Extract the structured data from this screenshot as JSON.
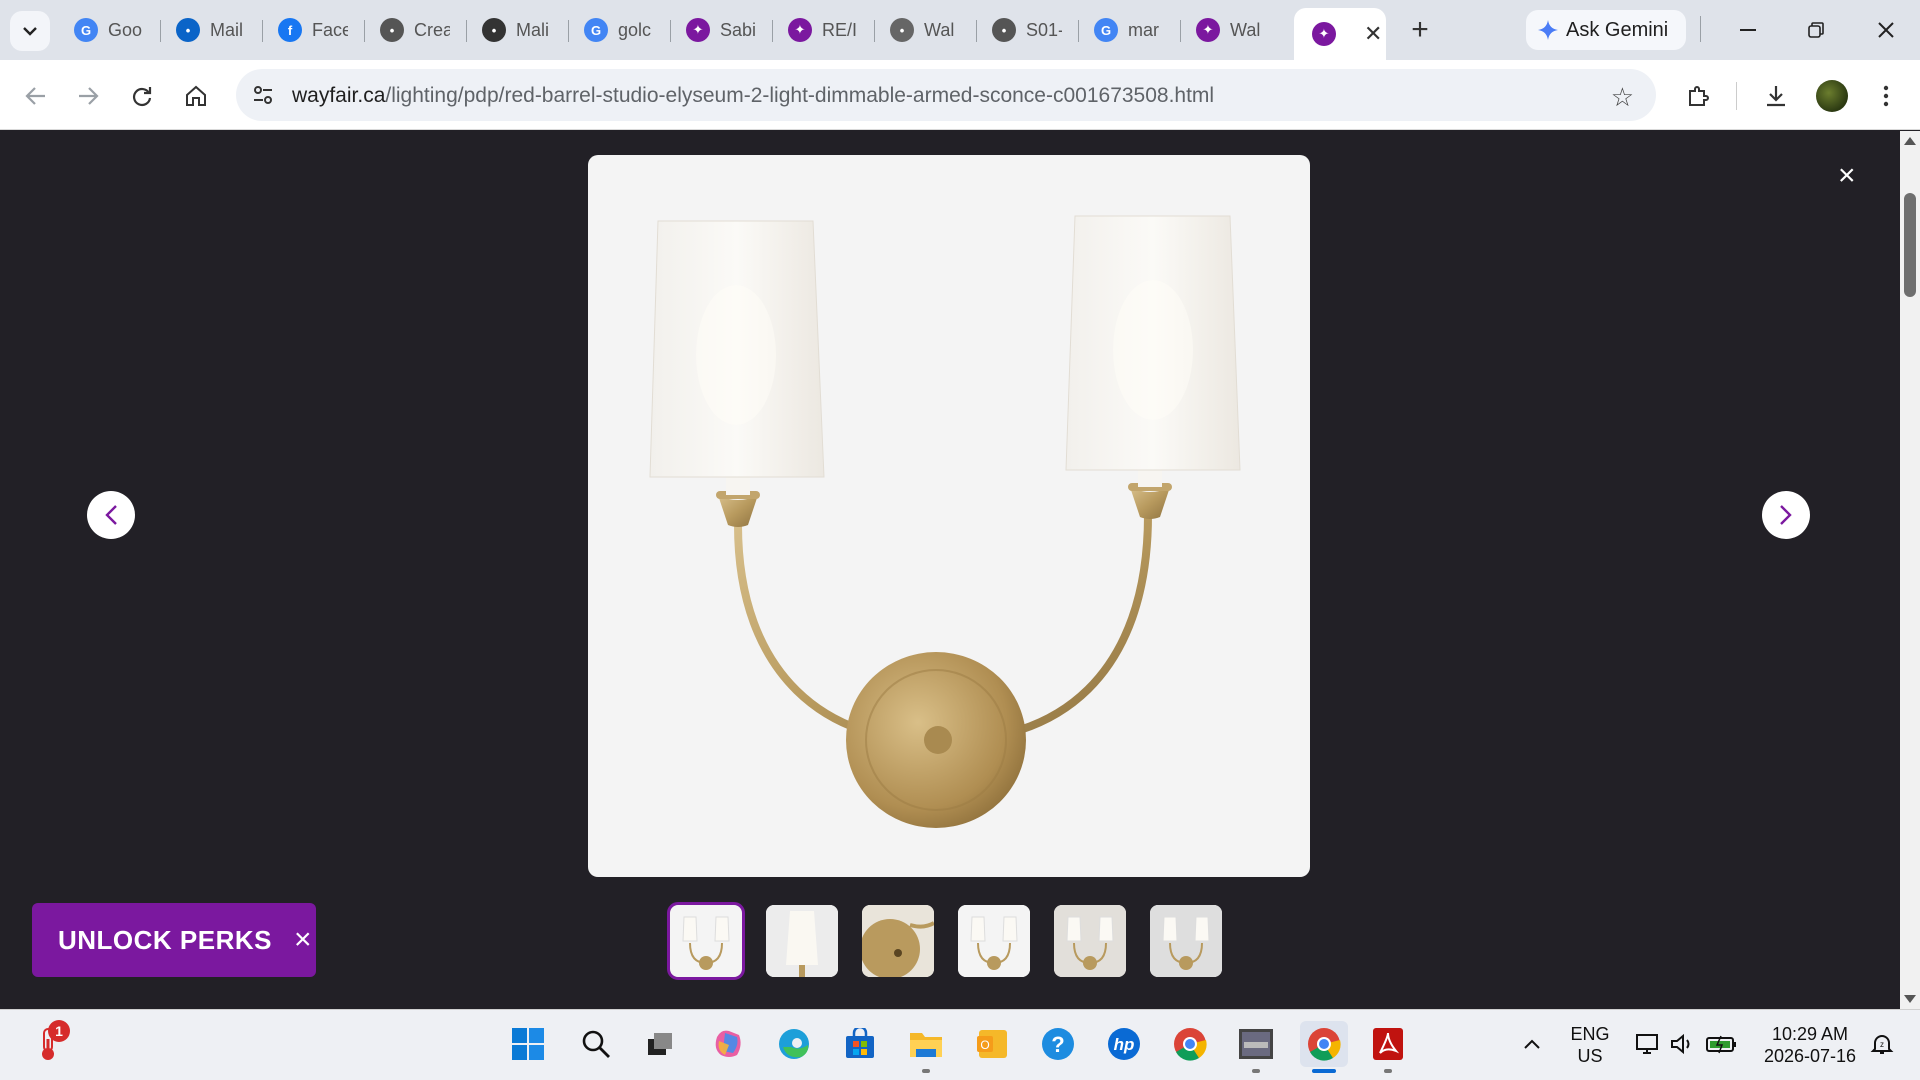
{
  "browser": {
    "tabs": [
      {
        "label": "Goo",
        "icon": "google-icon",
        "color": "#4285f4"
      },
      {
        "label": "Mail",
        "icon": "outlook-icon",
        "color": "#0a64c8"
      },
      {
        "label": "Face",
        "icon": "facebook-icon",
        "color": "#1877f2"
      },
      {
        "label": "Crea",
        "icon": "ssc-icon",
        "color": "#555555"
      },
      {
        "label": "Mali",
        "icon": "ecodor-icon",
        "color": "#333333"
      },
      {
        "label": "golc",
        "icon": "google-icon",
        "color": "#4285f4"
      },
      {
        "label": "Sabi",
        "icon": "wayfair-icon",
        "color": "#7b189f"
      },
      {
        "label": "RE/I",
        "icon": "wayfair-icon",
        "color": "#7b189f"
      },
      {
        "label": "Wal",
        "icon": "lh-icon",
        "color": "#666666"
      },
      {
        "label": "S01-",
        "icon": "globe-icon",
        "color": "#555555"
      },
      {
        "label": "mar",
        "icon": "google-icon",
        "color": "#4285f4"
      },
      {
        "label": "Wal",
        "icon": "wayfair-icon",
        "color": "#7b189f"
      }
    ],
    "active_tab_icon": "wayfair-icon",
    "new_tab": "+",
    "gemini_label": "Ask Gemini",
    "url_host": "wayfair.ca",
    "url_path": "/lighting/pdp/red-barrel-studio-elyseum-2-light-dimmable-armed-sconce-c001673508.html"
  },
  "viewer": {
    "close": "×",
    "perks_label": "UNLOCK PERKS",
    "perks_close": "×",
    "thumbnails": [
      "sconce-front",
      "shade-closeup",
      "backplate-closeup",
      "sconce-alt",
      "sconce-room",
      "sconce-wall"
    ],
    "selected_thumbnail": 1,
    "brand_color": "#7b189f"
  },
  "taskbar": {
    "weather_badge": "1",
    "lang_top": "ENG",
    "lang_bottom": "US",
    "time": "10:29 AM",
    "date": "2026-07-16"
  }
}
